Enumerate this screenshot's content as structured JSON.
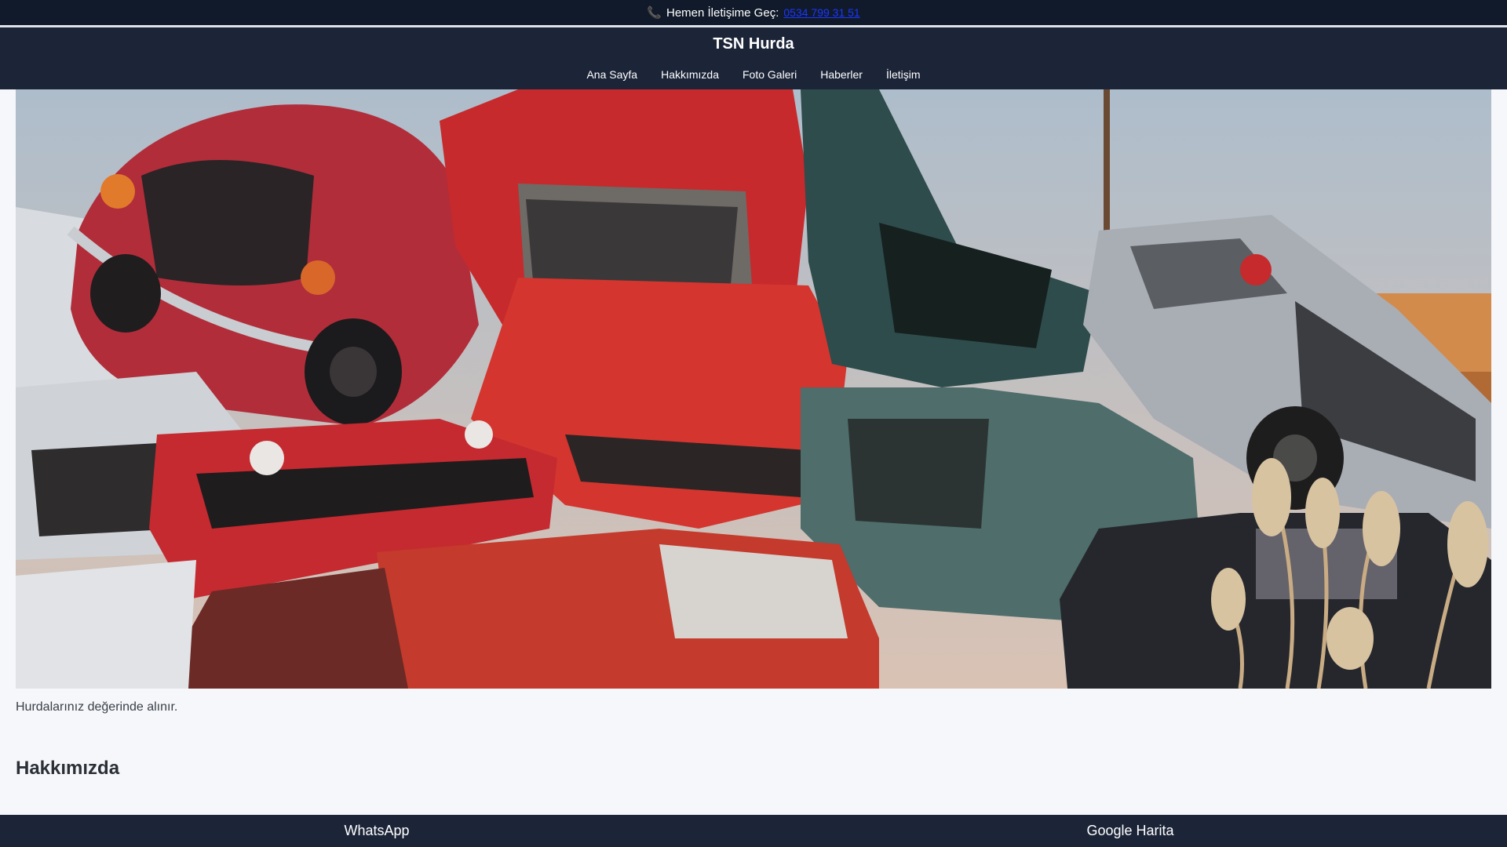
{
  "topbar": {
    "prefix": "Hemen İletişime Geç:",
    "phone": "0534 799 31 51",
    "icon": "phone-icon"
  },
  "header": {
    "title": "TSN Hurda",
    "nav": [
      "Ana Sayfa",
      "Hakkımızda",
      "Foto Galeri",
      "Haberler",
      "İletişim"
    ]
  },
  "hero": {
    "image": "scrapyard-cars-photo",
    "caption": "Hurdalarınız değerinde alınır."
  },
  "about": {
    "title": "Hakkımızda"
  },
  "bottom": {
    "whatsapp": "WhatsApp",
    "maps": "Google Harita"
  },
  "colors": {
    "topbar_bg": "#111a2a",
    "header_bg": "#1c2538",
    "link": "#1a37ff",
    "page_bg": "#f5f7fa"
  }
}
